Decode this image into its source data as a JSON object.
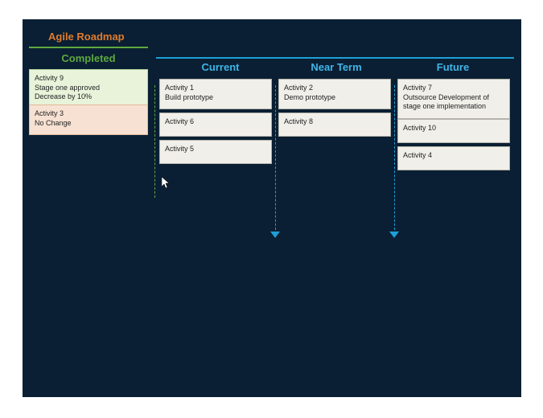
{
  "title": "Agile Roadmap",
  "columns": {
    "completed": {
      "header": "Completed",
      "cards": [
        {
          "title": "Activity 9",
          "line1": "Stage one approved",
          "line2": "Decrease by 10%"
        },
        {
          "title": "Activity 3",
          "line1": "No Change",
          "line2": ""
        }
      ]
    },
    "current": {
      "header": "Current",
      "cards": [
        {
          "title": "Activity 1",
          "line1": "Build prototype",
          "line2": ""
        },
        {
          "title": "Activity 6",
          "line1": "",
          "line2": ""
        },
        {
          "title": "Activity 5",
          "line1": "",
          "line2": ""
        }
      ]
    },
    "nearterm": {
      "header": "Near Term",
      "cards": [
        {
          "title": "Activity 2",
          "line1": "Demo prototype",
          "line2": ""
        },
        {
          "title": "Activity 8",
          "line1": "",
          "line2": ""
        }
      ]
    },
    "future": {
      "header": "Future",
      "cards": [
        {
          "title": "Activity 7",
          "line1": "Outsource Development of stage one implementation",
          "line2": ""
        },
        {
          "title": "Activity 10",
          "line1": "",
          "line2": ""
        },
        {
          "title": "Activity 4",
          "line1": "",
          "line2": ""
        }
      ]
    }
  }
}
